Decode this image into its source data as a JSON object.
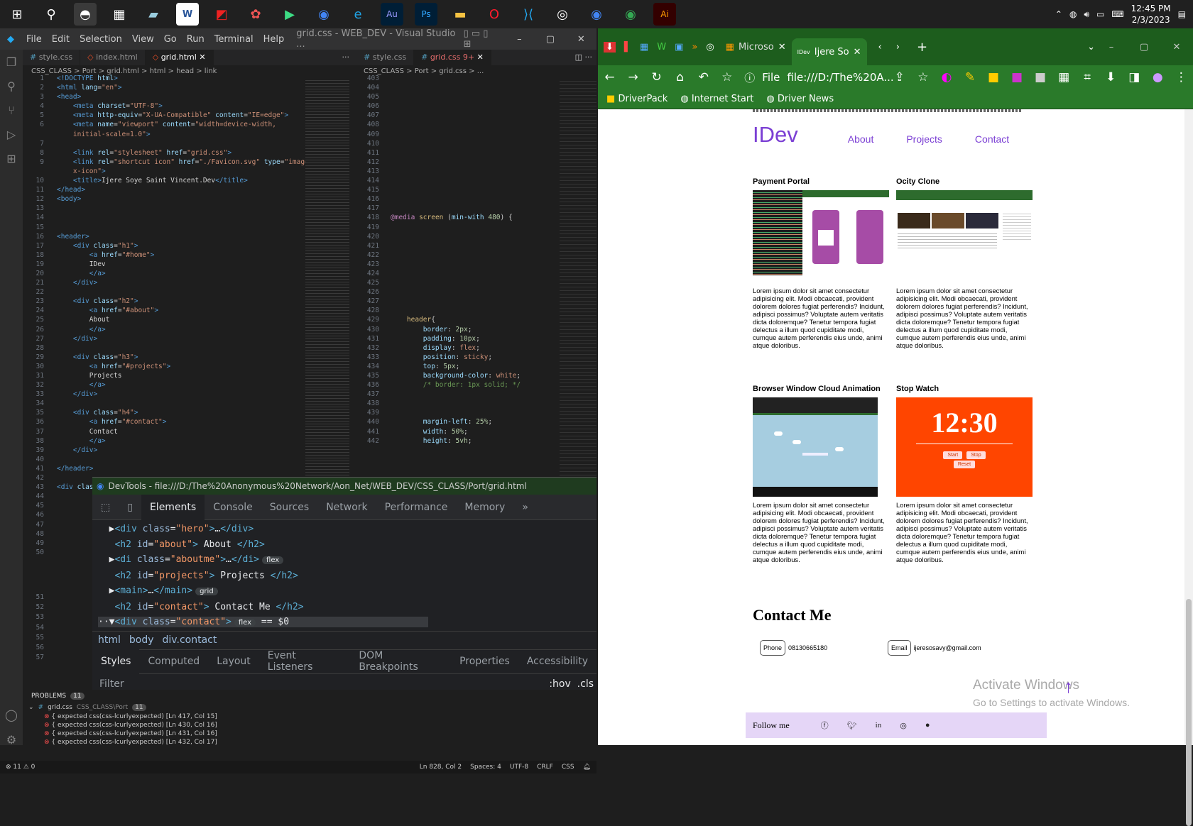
{
  "taskbar": {
    "time": "12:45 PM",
    "date": "2/3/2023"
  },
  "vscode": {
    "menu": [
      "File",
      "Edit",
      "Selection",
      "View",
      "Go",
      "Run",
      "Terminal",
      "Help"
    ],
    "window_title": "grid.css - WEB_DEV - Visual Studio ...",
    "left_tabs": [
      "style.css",
      "index.html",
      "grid.html"
    ],
    "right_tabs": [
      "style.css",
      "grid.css 9+"
    ],
    "left_breadcrumb": "CSS_CLASS > Port > grid.html > html > head > link",
    "right_breadcrumb": "CSS_CLASS > Port > grid.css > ...",
    "problems_label": "PROBLEMS",
    "problems_count": "11",
    "problem_file": "grid.css",
    "problem_path": "CSS_CLASS\\Port",
    "problems": [
      "{ expected css(css-lcurlyexpected) [Ln 417, Col 15]",
      "{ expected css(css-lcurlyexpected) [Ln 430, Col 16]",
      "{ expected css(css-lcurlyexpected) [Ln 431, Col 16]",
      "{ expected css(css-lcurlyexpected) [Ln 432, Col 17]"
    ],
    "status_left": "⊗ 11 ⚠ 0",
    "status_right": [
      "Ln 828, Col 2",
      "Spaces: 4",
      "UTF-8",
      "CRLF",
      "CSS"
    ]
  },
  "devtools": {
    "title": "DevTools - file:///D:/The%20Anonymous%20Network/Aon_Net/WEB_DEV/CSS_CLASS/Port/grid.html",
    "tabs": [
      "Elements",
      "Console",
      "Sources",
      "Network",
      "Performance",
      "Memory",
      "»"
    ],
    "breadcrumb": [
      "html",
      "body",
      "div.contact"
    ],
    "subtabs": [
      "Styles",
      "Computed",
      "Layout",
      "Event Listeners",
      "DOM Breakpoints",
      "Properties",
      "Accessibility"
    ],
    "filter_placeholder": "Filter",
    "filter_right": ":hov  .cls"
  },
  "browser": {
    "tabs": [
      "Microso",
      "Ijere So"
    ],
    "address": "file:///D:/The%20A...",
    "file_label": "File",
    "bookmarks": [
      "DriverPack",
      "Internet Start",
      "Driver News"
    ]
  },
  "site": {
    "logo": "IDev",
    "nav": [
      "About",
      "Projects",
      "Contact"
    ],
    "projects": [
      {
        "title": "Payment Portal",
        "desc": "Lorem ipsum dolor sit amet consectetur adipisicing elit. Modi obcaecati, provident dolorem dolores fugiat perferendis? Incidunt, adipisci possimus? Voluptate autem veritatis dicta doloremque? Tenetur tempora fugiat delectus a illum quod cupiditate modi, cumque autem perferendis eius unde, animi atque doloribus."
      },
      {
        "title": "Ocity Clone",
        "desc": "Lorem ipsum dolor sit amet consectetur adipisicing elit. Modi obcaecati, provident dolorem dolores fugiat perferendis? Incidunt, adipisci possimus? Voluptate autem veritatis dicta doloremque? Tenetur tempora fugiat delectus a illum quod cupiditate modi, cumque autem perferendis eius unde, animi atque doloribus."
      },
      {
        "title": "Browser Window Cloud Animation",
        "desc": "Lorem ipsum dolor sit amet consectetur adipisicing elit. Modi obcaecati, provident dolorem dolores fugiat perferendis? Incidunt, adipisci possimus? Voluptate autem veritatis dicta doloremque? Tenetur tempora fugiat delectus a illum quod cupiditate modi, cumque autem perferendis eius unde, animi atque doloribus."
      },
      {
        "title": "Stop Watch",
        "desc": "Lorem ipsum dolor sit amet consectetur adipisicing elit. Modi obcaecati, provident dolorem dolores fugiat perferendis? Incidunt, adipisci possimus? Voluptate autem veritatis dicta doloremque? Tenetur tempora fugiat delectus a illum quod cupiditate modi, cumque autem perferendis eius unde, animi atque doloribus."
      }
    ],
    "stopwatch": {
      "time": "12:30",
      "buttons": [
        "Start",
        "Stop",
        "Reset"
      ]
    },
    "contact_heading": "Contact Me",
    "phone_label": "Phone",
    "phone": "08130665180",
    "email_label": "Email",
    "email": "ijeresosavy@gmail.com",
    "follow": "Follow me",
    "watermark_title": "Activate Windows",
    "watermark_sub": "Go to Settings to activate Windows."
  },
  "colors": {
    "accent": "#7b3fd4",
    "browser_green": "#2a7a2a",
    "stopwatch_bg": "#ff4500",
    "footer_bg": "#e5d6f7"
  }
}
